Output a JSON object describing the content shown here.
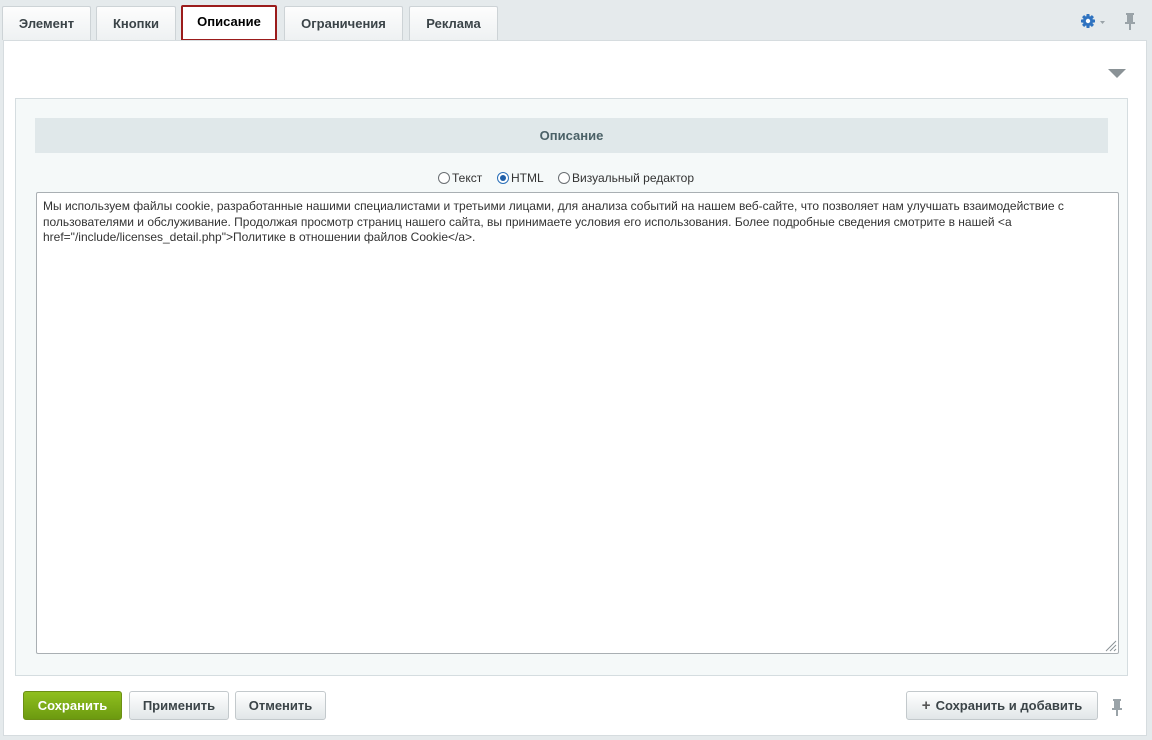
{
  "tabs": [
    {
      "label": "Элемент"
    },
    {
      "label": "Кнопки"
    },
    {
      "label": "Описание",
      "active": true
    },
    {
      "label": "Ограничения"
    },
    {
      "label": "Реклама"
    }
  ],
  "section": {
    "title": "Описание"
  },
  "editor_modes": [
    {
      "label": "Текст",
      "checked": false
    },
    {
      "label": "HTML",
      "checked": true
    },
    {
      "label": "Визуальный редактор",
      "checked": false
    }
  ],
  "editor": {
    "value": "Мы используем файлы cookie, разработанные нашими специалистами и третьими лицами, для анализа событий на нашем веб-сайте, что позволяет нам улучшать взаимодействие с пользователями и обслуживание. Продолжая просмотр страниц нашего сайта, вы принимаете условия его использования. Более подробные сведения смотрите в нашей <a href=\"/include/licenses_detail.php\">Политике в отношении файлов Cookie</a>."
  },
  "buttons": {
    "save": "Сохранить",
    "apply": "Применить",
    "cancel": "Отменить",
    "save_and_add": "Сохранить и добавить"
  },
  "colors": {
    "accent": "#1f5fa8",
    "primary_button": "#7aab14",
    "active_tab_border": "#9b1b1b"
  },
  "icons": {
    "settings": "gear-icon",
    "pin": "pin-icon",
    "collapse": "triangle-down-icon",
    "add": "plus-icon"
  }
}
